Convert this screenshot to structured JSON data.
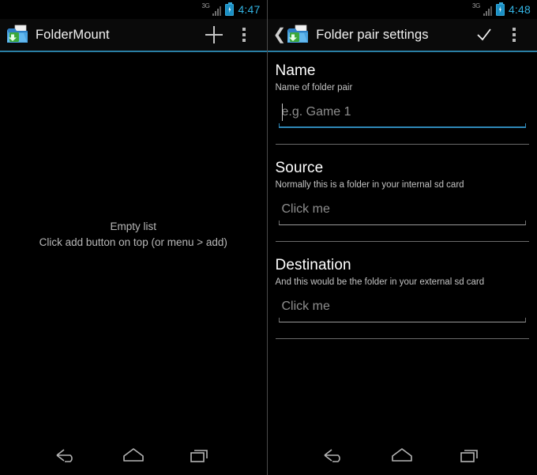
{
  "left": {
    "status": {
      "network_label": "3G",
      "time": "4:47",
      "signal_icon": "signal-bars-icon",
      "battery_icon": "battery-charging-icon"
    },
    "action_bar": {
      "app_icon": "folder-download-icon",
      "title": "FolderMount",
      "add_icon": "plus-icon",
      "overflow_icon": "overflow-menu-icon"
    },
    "empty_state": {
      "line1": "Empty list",
      "line2": "Click add button on top (or menu > add)"
    }
  },
  "right": {
    "status": {
      "network_label": "3G",
      "time": "4:48",
      "signal_icon": "signal-bars-icon",
      "battery_icon": "battery-charging-icon"
    },
    "action_bar": {
      "back_icon": "back-chevron-icon",
      "app_icon": "folder-download-icon",
      "title": "Folder pair settings",
      "confirm_icon": "checkmark-icon",
      "overflow_icon": "overflow-menu-icon"
    },
    "sections": [
      {
        "title": "Name",
        "subtitle": "Name of folder pair",
        "field_placeholder": "e.g. Game 1",
        "field_value": "",
        "focused": true
      },
      {
        "title": "Source",
        "subtitle": "Normally this is a folder in your internal sd card",
        "field_placeholder": "Click me",
        "field_value": "",
        "focused": false
      },
      {
        "title": "Destination",
        "subtitle": "And this would be the folder in your external sd card",
        "field_placeholder": "Click me",
        "field_value": "",
        "focused": false
      }
    ]
  },
  "nav_bar": {
    "back": "back-nav-icon",
    "home": "home-nav-icon",
    "recents": "recents-nav-icon"
  },
  "colors": {
    "accent_blue": "#33b5e5",
    "divider_blue": "#2a7fa5",
    "background": "#000000",
    "text_primary": "#ffffff",
    "text_secondary": "#c3c3c3",
    "hint": "#8e8e8e"
  }
}
